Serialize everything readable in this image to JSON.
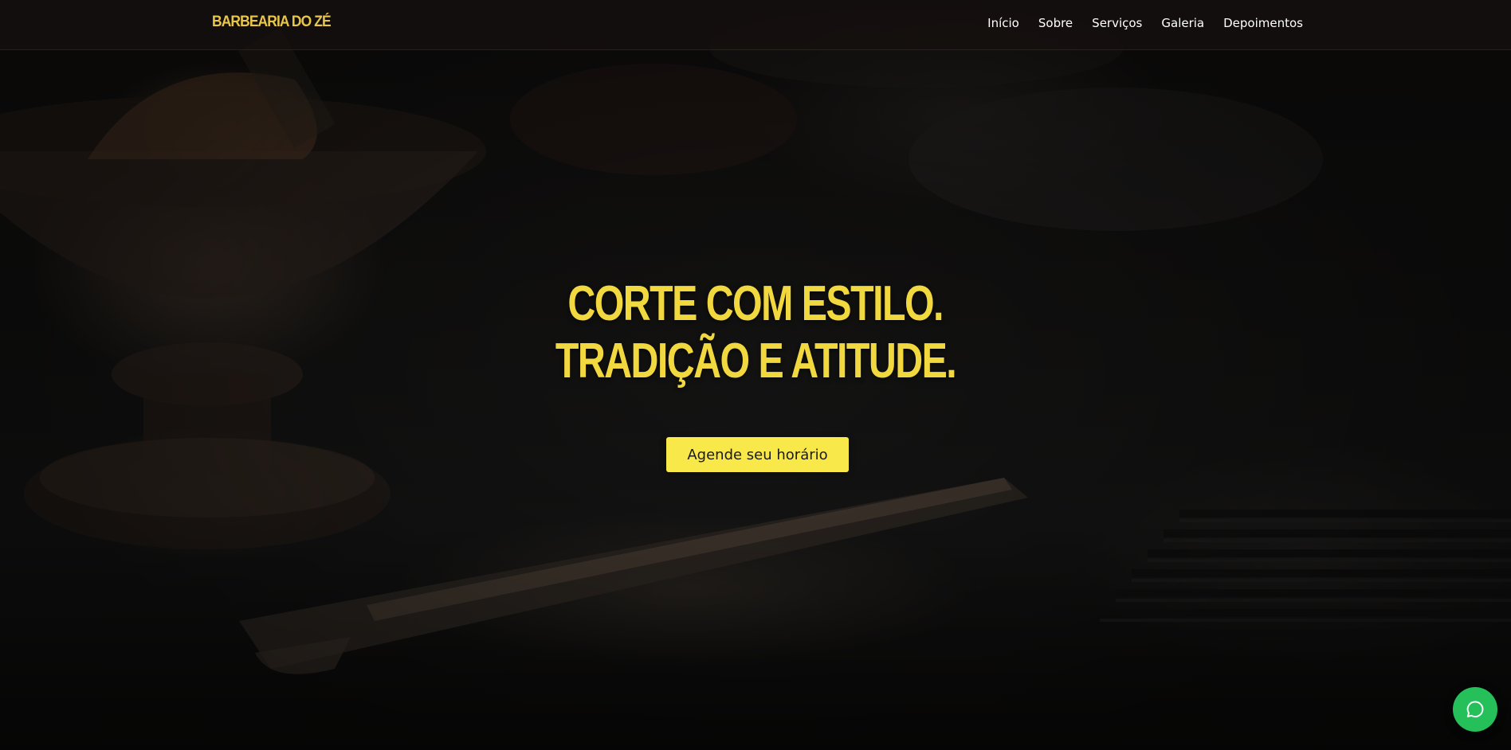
{
  "navbar": {
    "brand": "BARBEARIA DO ZÉ",
    "links": [
      {
        "label": "Início"
      },
      {
        "label": "Sobre"
      },
      {
        "label": "Serviços"
      },
      {
        "label": "Galeria"
      },
      {
        "label": "Depoimentos"
      }
    ]
  },
  "hero": {
    "headline_line1": "CORTE COM ESTILO.",
    "headline_line2": "TRADIÇÃO E ATITUDE.",
    "cta_label": "Agende seu horário"
  },
  "floating": {
    "icon": "whatsapp-chat-icon"
  },
  "colors": {
    "accent": "#f9e84a",
    "brand": "#e8c64a",
    "headline": "#f2d83f",
    "whatsapp": "#25c05a",
    "navbar_bg": "#16110f"
  }
}
